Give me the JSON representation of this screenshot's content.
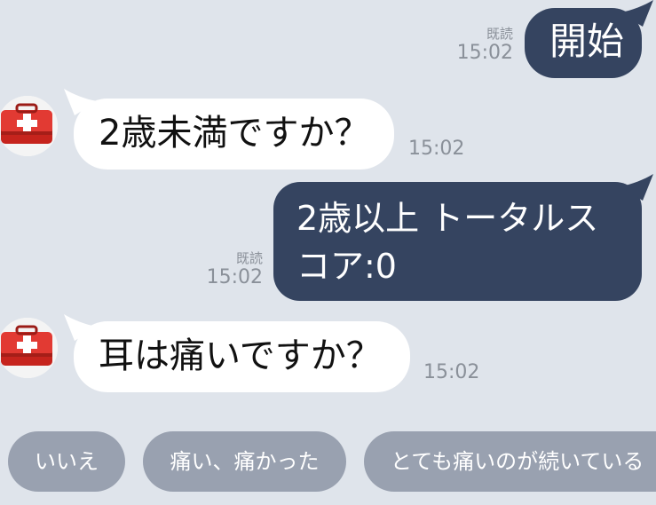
{
  "messages": [
    {
      "side": "out",
      "text": "開始",
      "read": "既読",
      "time": "15:02"
    },
    {
      "side": "in",
      "text": "2歳未満ですか？",
      "time": "15:02"
    },
    {
      "side": "out",
      "text": "2歳以上 トータルス\nコア:0",
      "read": "既読",
      "time": "15:02"
    },
    {
      "side": "in",
      "text": "耳は痛いですか？",
      "time": "15:02"
    }
  ],
  "quick_replies": [
    "いいえ",
    "痛い、痛かった",
    "とても痛いのが続いている"
  ],
  "colors": {
    "background": "#dfe4eb",
    "outgoing_bubble": "#354460",
    "incoming_bubble": "#ffffff",
    "quick_reply": "#99a1b0",
    "timestamp": "#8a9099",
    "avatar_red": "#e23a33"
  },
  "icons": {
    "avatar": "first-aid-kit-icon"
  }
}
